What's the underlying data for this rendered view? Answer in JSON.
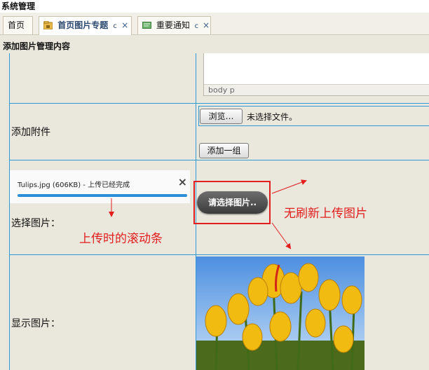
{
  "app": {
    "title": "系统管理"
  },
  "tabs": [
    {
      "label": "首页"
    },
    {
      "label": "首页图片专题",
      "ctrl": "c",
      "close": "×"
    },
    {
      "label": "重要通知",
      "ctrl": "c",
      "close": "×"
    }
  ],
  "section_title": "添加图片管理内容",
  "editor": {
    "status": "body  p"
  },
  "attachment": {
    "label": "添加附件",
    "browse_label": "浏览…",
    "no_file_text": "未选择文件。",
    "add_group_label": "添加一组"
  },
  "picker": {
    "label": "选择图片：",
    "upload_item": "Tulips.jpg (606KB) - 上传已经完成",
    "close": "×",
    "progress": 1.0,
    "button_label": "请选择图片.."
  },
  "annotations": {
    "progress_note": "上传时的滚动条",
    "upload_note": "无刷新上传图片"
  },
  "display": {
    "label": "显示图片："
  },
  "colors": {
    "grid": "#2f9ad6",
    "annotation": "#e31c1c",
    "progress": "#2b8ed6"
  },
  "icons": {
    "tab1": "folder-lock-icon",
    "tab2": "note-icon"
  }
}
